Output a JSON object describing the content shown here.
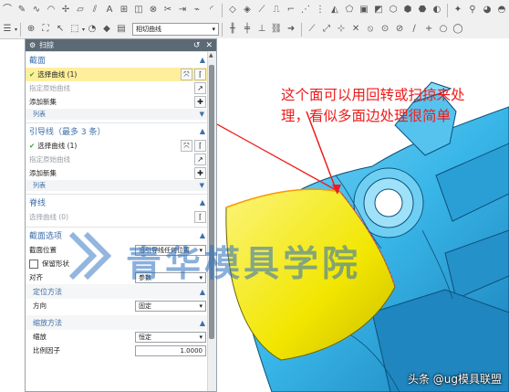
{
  "toolbar2": {
    "filter_select": "相切曲线"
  },
  "dialog": {
    "title": "扫掠",
    "sections": {
      "section_curves": {
        "header": "截面",
        "select_curve": "选择曲线 (1)",
        "specify_origin": "指定原始曲线",
        "add_new_set": "添加新集",
        "list": "列表"
      },
      "guides": {
        "header": "引导线（最多 3 条）",
        "select_curve": "选择曲线 (1)",
        "specify_origin": "指定原始曲线",
        "add_new_set": "添加新集",
        "list": "列表"
      },
      "spine": {
        "header": "脊线",
        "select_curve": "选择曲线 (0)"
      },
      "section_options": {
        "header": "截面选项",
        "position_label": "截面位置",
        "position_value": "沿引导线任何位置",
        "keep_shape": "保留形状",
        "align_label": "对齐",
        "align_value": "参数",
        "orientation": {
          "header": "定位方法",
          "direction_label": "方向",
          "direction_value": "固定"
        },
        "scaling": {
          "header": "缩放方法",
          "scale_label": "缩放",
          "scale_value": "恒定",
          "ratio_label": "比例因子",
          "ratio_value": "1.0000"
        }
      }
    }
  },
  "annotation": "这个面可以用回转或扫掠来处理，看似多面边处理很简单",
  "watermark": "青华模具学院",
  "footer": "头条 @ug模具联盟",
  "colors": {
    "model_cyan": "#39b6e8",
    "highlight_yellow": "#f2e600",
    "annotation_red": "#ee1c1c",
    "dialog_title": "#5b6a75",
    "section_blue": "#3f6fa8"
  }
}
